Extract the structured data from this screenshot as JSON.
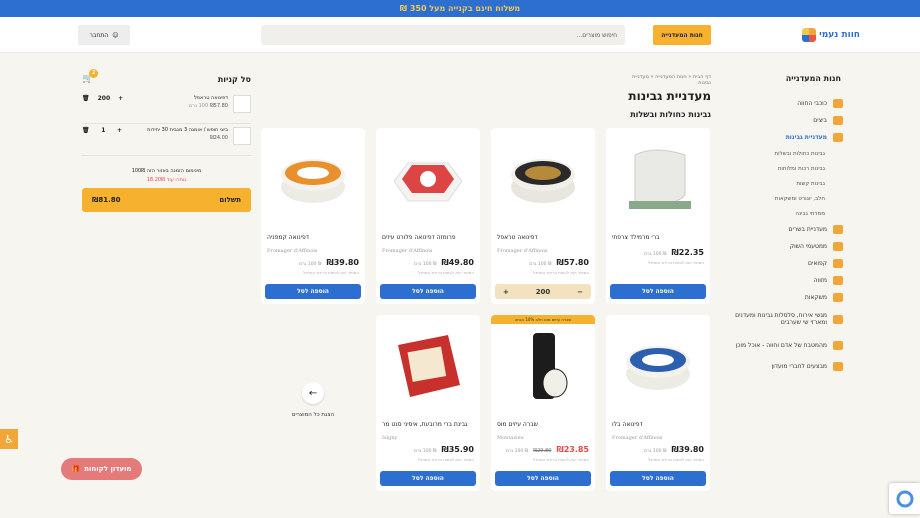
{
  "topbar": {
    "text": "משלוח חינם בקנייה מעל 350 ₪"
  },
  "header": {
    "logo_text": "חוות נעמי",
    "store_button": "חנות המעדנייה",
    "search_placeholder": "חיפוש מוצרים...",
    "login_label": "התחבר"
  },
  "sidebar": {
    "title": "חנות המעדנייה",
    "categories": [
      {
        "label": "כוכבי החווה",
        "color": "#f2a63a"
      },
      {
        "label": "ביצים",
        "color": "#f2a63a"
      },
      {
        "label": "מעדניית גבינות",
        "color": "#f2a63a",
        "active": true
      },
      {
        "label": "גבינות כחולות ובשלות",
        "sub": true
      },
      {
        "label": "גבינות רכות ומלוחות",
        "sub": true
      },
      {
        "label": "גבינות קשות",
        "sub": true
      },
      {
        "label": "חלב, יוגורט ומשקאות",
        "sub": true
      },
      {
        "label": "ממרחי גבינה",
        "sub": true
      },
      {
        "label": "מעדניית בשרים",
        "color": "#f2a63a"
      },
      {
        "label": "ממטעמי השוק",
        "color": "#f2a63a"
      },
      {
        "label": "קפואים",
        "color": "#f2a63a"
      },
      {
        "label": "מזווה",
        "color": "#f2a63a"
      },
      {
        "label": "משקאות",
        "color": "#f2a63a"
      },
      {
        "label": "מגשי אירוח, סלסלות גבינות ומעדנים ומארזי שי שערבים",
        "color": "#f2a63a"
      },
      {
        "label": "מהמטבח של אדם וחווה - אוכל מוכן",
        "color": "#f2a63a"
      },
      {
        "label": "מבצעים לחברי מועדון",
        "color": "#f2a63a"
      }
    ]
  },
  "main": {
    "breadcrumb": "דף הבית « חנות המעדנייה « מעדניית גבינות",
    "title": "מעדניית גבינות",
    "subtitle": "גבינות כחולות ובשלות",
    "add_label": "הוספה לסל",
    "price_unit": "ל-100 גרם",
    "price_note": "המחיר הוא לכמות ברירת המחדל",
    "products": [
      {
        "name": "ברי מרמילד צרפתי",
        "brand": "",
        "price": "₪22.35",
        "unit": "₪  100 גרם",
        "type": "wheel-pale"
      },
      {
        "name": "דפינואה טראפל",
        "brand": "Fromager d'Affinois",
        "price": "₪57.80",
        "unit": "₪  100 גרם",
        "type": "truffle",
        "qty": "200"
      },
      {
        "name": "פרומזה דפינואה פלורט עיזים",
        "brand": "Fromager d'Affinois",
        "price": "₪49.80",
        "unit": "₪  100 גרם",
        "type": "hexagon"
      },
      {
        "name": "דפינואה קמפניה",
        "brand": "Fromager d'Affinois",
        "price": "₪39.80",
        "unit": "₪  100 גרם",
        "type": "wheel-orange"
      },
      {
        "name": "דפינואה בלו",
        "brand": "Fromager d'Affinois",
        "price": "₪39.80",
        "unit": "₪  100 גרם",
        "type": "wheel-blue"
      },
      {
        "name": "שברה עיזים מוס",
        "brand": "Montazieu",
        "price": "₪23.85",
        "old_price": "₪29.80",
        "unit": "₪  100 גרם",
        "sale": true,
        "ribbon": "שברה עיזים מוס חלב 10% הנחה",
        "type": "log"
      },
      {
        "name": "גבינת ברי מרובעת, איסיני סנט מר",
        "brand": "Isigny",
        "price": "₪35.90",
        "unit": "₪  100 גרם",
        "type": "box-red"
      }
    ],
    "all_products_label": "הצגת כל המוצרים"
  },
  "cart": {
    "title": "סל קניות",
    "count": "2",
    "items": [
      {
        "name": "דפינואה טראפל",
        "qty_price": "₪57.80",
        "unit": "100 גרם",
        "qty": "200"
      },
      {
        "name": "ביצי חופש / אומגה 3 מגבית 30 יחידות",
        "qty_price": "₪24.00",
        "unit": "",
        "qty": "1"
      }
    ],
    "min_text": "מינימום הזמנה באזור הזה 100₪",
    "min_remaining": "נותרו עוד 18.20₪",
    "checkout_label": "תשלום",
    "total": "₪81.80"
  },
  "club_button": "מועדון לקוחות"
}
